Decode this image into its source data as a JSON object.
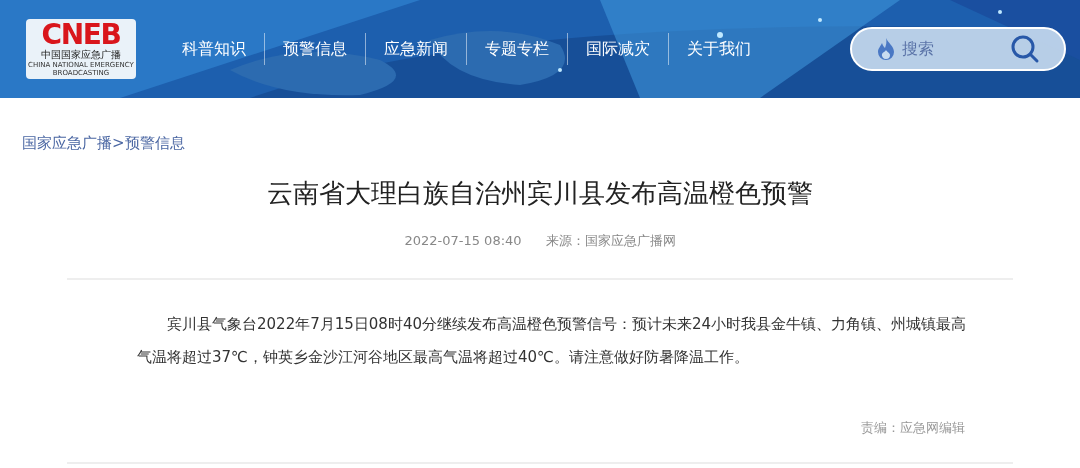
{
  "logo": {
    "mark": "CNEB",
    "name": "中国国家应急广播",
    "english": "CHINA NATIONAL EMERGENCY BROADCASTING"
  },
  "nav": [
    {
      "label": "科普知识"
    },
    {
      "label": "预警信息"
    },
    {
      "label": "应急新闻"
    },
    {
      "label": "专题专栏"
    },
    {
      "label": "国际减灾"
    },
    {
      "label": "关于我们"
    }
  ],
  "search": {
    "placeholder": "搜索"
  },
  "breadcrumb": [
    {
      "label": "国家应急广播"
    },
    {
      "label": "预警信息"
    }
  ],
  "breadcrumb_separator": ">",
  "article": {
    "title": "云南省大理白族自治州宾川县发布高温橙色预警",
    "date": "2022-07-15 08:40",
    "source": "来源：国家应急广播网",
    "body": "宾川县气象台2022年7月15日08时40分继续发布高温橙色预警信号：预计未来24小时我县金牛镇、力角镇、州城镇最高气温将超过37℃，钟英乡金沙江河谷地区最高气温将超过40℃。请注意做好防暑降温工作。",
    "editor": "责编：应急网编辑"
  }
}
